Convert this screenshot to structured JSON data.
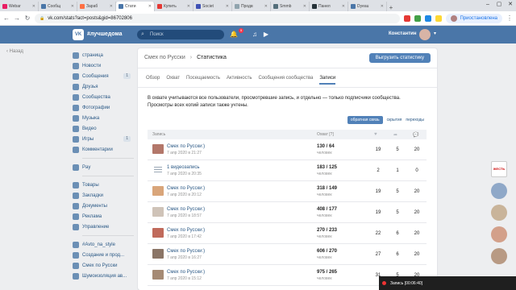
{
  "browser": {
    "tabs": [
      {
        "label": "Webar",
        "color": "#e91e63"
      },
      {
        "label": "Сообщ",
        "color": "#4a76a8"
      },
      {
        "label": "Зараб",
        "color": "#ff7043"
      },
      {
        "label": "Стати",
        "color": "#4a76a8",
        "active": true
      },
      {
        "label": "Купить",
        "color": "#e53935"
      },
      {
        "label": "Societ",
        "color": "#3f51b5"
      },
      {
        "label": "Продв",
        "color": "#90a4ae"
      },
      {
        "label": "Smmb",
        "color": "#546e7a"
      },
      {
        "label": "Панел",
        "color": "#263238"
      },
      {
        "label": "Dyeau",
        "color": "#4a76a8"
      }
    ],
    "url": "vk.com/stats?act=posts&gid=86702806",
    "profile_label": "Приостановлена"
  },
  "vk_header": {
    "brand": "#лучшедома",
    "search_placeholder": "Поиск",
    "notif_count": "5",
    "username": "Константин"
  },
  "back_link": "Назад",
  "left_menu": {
    "items": [
      {
        "label": "страница",
        "count": ""
      },
      {
        "label": "Новости",
        "count": ""
      },
      {
        "label": "Сообщения",
        "count": "1"
      },
      {
        "label": "Друзья",
        "count": ""
      },
      {
        "label": "Сообщества",
        "count": ""
      },
      {
        "label": "Фотографии",
        "count": ""
      },
      {
        "label": "Музыка",
        "count": ""
      },
      {
        "label": "Видео",
        "count": ""
      },
      {
        "label": "Игры",
        "count": "1"
      },
      {
        "label": "Комментарии",
        "count": ""
      }
    ],
    "pay": "Pay",
    "items2": [
      {
        "label": "Товары"
      },
      {
        "label": "Закладки"
      },
      {
        "label": "Документы"
      },
      {
        "label": "Реклама"
      },
      {
        "label": "Управление"
      }
    ],
    "items3": [
      {
        "label": "#Avto_na_style"
      },
      {
        "label": "Создание и прод..."
      },
      {
        "label": "Смех по Русски"
      },
      {
        "label": "Шумоизоляция ав..."
      }
    ]
  },
  "page": {
    "crumb_group": "Смех по Русски",
    "crumb_sep": "›",
    "crumb_page": "Статистика",
    "export_label": "Выгрузить статистику",
    "tabs": [
      "Обзор",
      "Охват",
      "Посещаемость",
      "Активность",
      "Сообщения сообщества",
      "Записи"
    ],
    "note": "В охвате учитываются все пользователи, просмотревшие запись, и отдельно — только подписчики сообщества. Просмотры всех копий записи также учтены.",
    "filters": [
      "обратная связь",
      "скрытия",
      "переходы"
    ],
    "table_head": {
      "post": "Запись",
      "reach": "Охват [?]"
    },
    "rows": [
      {
        "title": "Смех по Русски:)",
        "date": "7 апр 2020 в 21:27",
        "reach": "130 / 64",
        "reach_label": "человек",
        "likes": "19",
        "reposts": "5",
        "comments": "20",
        "thumb": "#b3776a"
      },
      {
        "title": "1 видеозапись",
        "date": "7 апр 2020 в 20:35",
        "reach": "183 / 125",
        "reach_label": "человек",
        "likes": "2",
        "reposts": "1",
        "comments": "0",
        "thumb": "doc"
      },
      {
        "title": "Смех по Русски:)",
        "date": "7 апр 2020 в 20:12",
        "reach": "318 / 149",
        "reach_label": "человек",
        "likes": "19",
        "reposts": "5",
        "comments": "20",
        "thumb": "#d9a57a"
      },
      {
        "title": "Смех по Русски:)",
        "date": "7 апр 2020 в 18:57",
        "reach": "408 / 177",
        "reach_label": "человек",
        "likes": "19",
        "reposts": "5",
        "comments": "20",
        "thumb": "#cfc3b8"
      },
      {
        "title": "Смех по Русски:)",
        "date": "7 апр 2020 в 17:42",
        "reach": "270 / 233",
        "reach_label": "человек",
        "likes": "22",
        "reposts": "6",
        "comments": "20",
        "thumb": "#c06a5b"
      },
      {
        "title": "Смех по Русски:)",
        "date": "7 апр 2020 в 16:27",
        "reach": "606 / 270",
        "reach_label": "человек",
        "likes": "27",
        "reposts": "6",
        "comments": "20",
        "thumb": "#8a7566"
      },
      {
        "title": "Смех по Русски:)",
        "date": "7 апр 2020 в 15:12",
        "reach": "975 / 265",
        "reach_label": "человек",
        "likes": "31",
        "reposts": "5",
        "comments": "20",
        "thumb": "#a58a74"
      }
    ]
  },
  "right_strip": {
    "logo_text": "ЖЕСТЬ"
  },
  "taskbar": {
    "label": "Запись [00:06:40]"
  }
}
